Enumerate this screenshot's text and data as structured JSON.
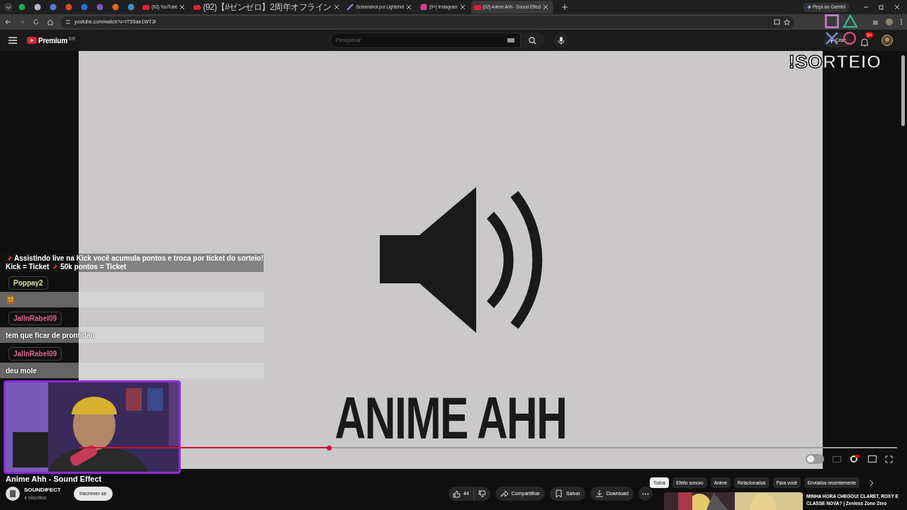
{
  "browser": {
    "tabs": [
      {
        "label": "(92) YouTube",
        "selected": false,
        "kind": "youtube"
      },
      {
        "label": "(92)【#ゼンゼロ】2周年オフライン",
        "selected": false,
        "kind": "youtube"
      },
      {
        "label": "Screenshot por Lightshot",
        "selected": false,
        "kind": "feather"
      },
      {
        "label": "(9+) Instagram",
        "selected": false,
        "kind": "instagram"
      },
      {
        "label": "(92) Anime Ahh - Sound Effect",
        "selected": true,
        "kind": "youtube"
      }
    ],
    "gemini_button": "Peça ao Gemini",
    "url": "youtube.com/watch?v=IT5Sae1WT3I"
  },
  "youtube": {
    "logo": "Premium",
    "region": "BR",
    "search_placeholder": "Pesquisar",
    "create_button": "Criar",
    "notification_count": "9+"
  },
  "video": {
    "art_text": "ANIME AHH",
    "progress": {
      "level": 0.306
    }
  },
  "stream_overlay": {
    "giveaway": "!SORTEIO",
    "chat": [
      {
        "kind": "pinned",
        "text": "Assistindo live na Kick você acumula pontos e troca por ticket do sorteio!",
        "text2": "Kick = Ticket",
        "text3": "50k pontos = Ticket"
      },
      {
        "kind": "emote",
        "user": "Poppay2",
        "color": "#d7e09a"
      },
      {
        "kind": "message",
        "user": "JalInRabel09",
        "color": "#e0628e",
        "text": "tem que ficar de prontidão"
      },
      {
        "kind": "message",
        "user": "JalInRabel09",
        "color": "#e0628e",
        "text": "deu mole"
      }
    ]
  },
  "below_video": {
    "title": "Anime Ahh - Sound Effect",
    "channel": "SOUNDIFECT",
    "subscribers": "4 inscritos",
    "subscribe_button": "Inscrever-se",
    "likes": "44",
    "actions": [
      "Compartilhar",
      "Salvar",
      "Download"
    ],
    "chips": [
      {
        "label": "Todos",
        "selected": true
      },
      {
        "label": "Efeito sonoro",
        "selected": false
      },
      {
        "label": "Anime",
        "selected": false
      },
      {
        "label": "Relacionados",
        "selected": false
      },
      {
        "label": "Para você",
        "selected": false
      },
      {
        "label": "Enviados recentemente",
        "selected": false
      }
    ],
    "recommended": {
      "title": "MINHA HORA CHEGOU! CLARET, ROXY E CLASSE NOVA? | Zenless Zone Zero"
    }
  }
}
